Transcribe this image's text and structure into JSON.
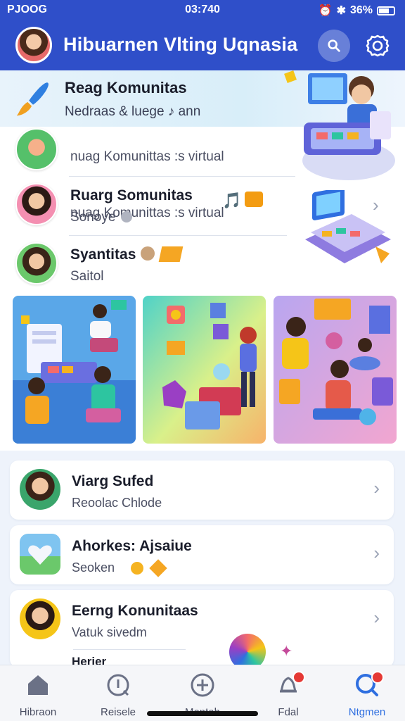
{
  "status_bar": {
    "carrier": "PJOOG",
    "time": "03:740",
    "battery": "36%"
  },
  "header": {
    "title": "Hibuarnen  Vlting Uqnasia"
  },
  "banner": {
    "title": "Reag Komunitas",
    "subtitle": "Nedraas  &  luege  ♪  ann"
  },
  "rows": [
    {
      "title": "",
      "subtitle": "nuag Komunittas :s virtual"
    },
    {
      "title": "Ruarg Somunitas",
      "subtitle": "Sonoye"
    },
    {
      "title": "Syantitas",
      "subtitle": "Saitol"
    }
  ],
  "list": [
    {
      "title": "Viarg Sufed",
      "subtitle": "Reoolac Chlode"
    },
    {
      "title": "Ahorkes: Ajsaiue",
      "subtitle": "Seoken"
    },
    {
      "title": "Eerng Konunitaas",
      "subtitle": "Vatuk sivedm"
    },
    {
      "title": "Herier"
    }
  ],
  "nav": [
    {
      "label": "Hibraon",
      "icon": "home-icon"
    },
    {
      "label": "Reisele",
      "icon": "info-icon"
    },
    {
      "label": "Mentah",
      "icon": "plus-circle-icon"
    },
    {
      "label": "Fdal",
      "icon": "bell-icon"
    },
    {
      "label": "Ntgmen",
      "icon": "search-icon"
    }
  ],
  "colors": {
    "primary": "#2f4fc9",
    "active_nav": "#2f6fe0",
    "badge": "#e53935",
    "background": "#eef3fb"
  }
}
